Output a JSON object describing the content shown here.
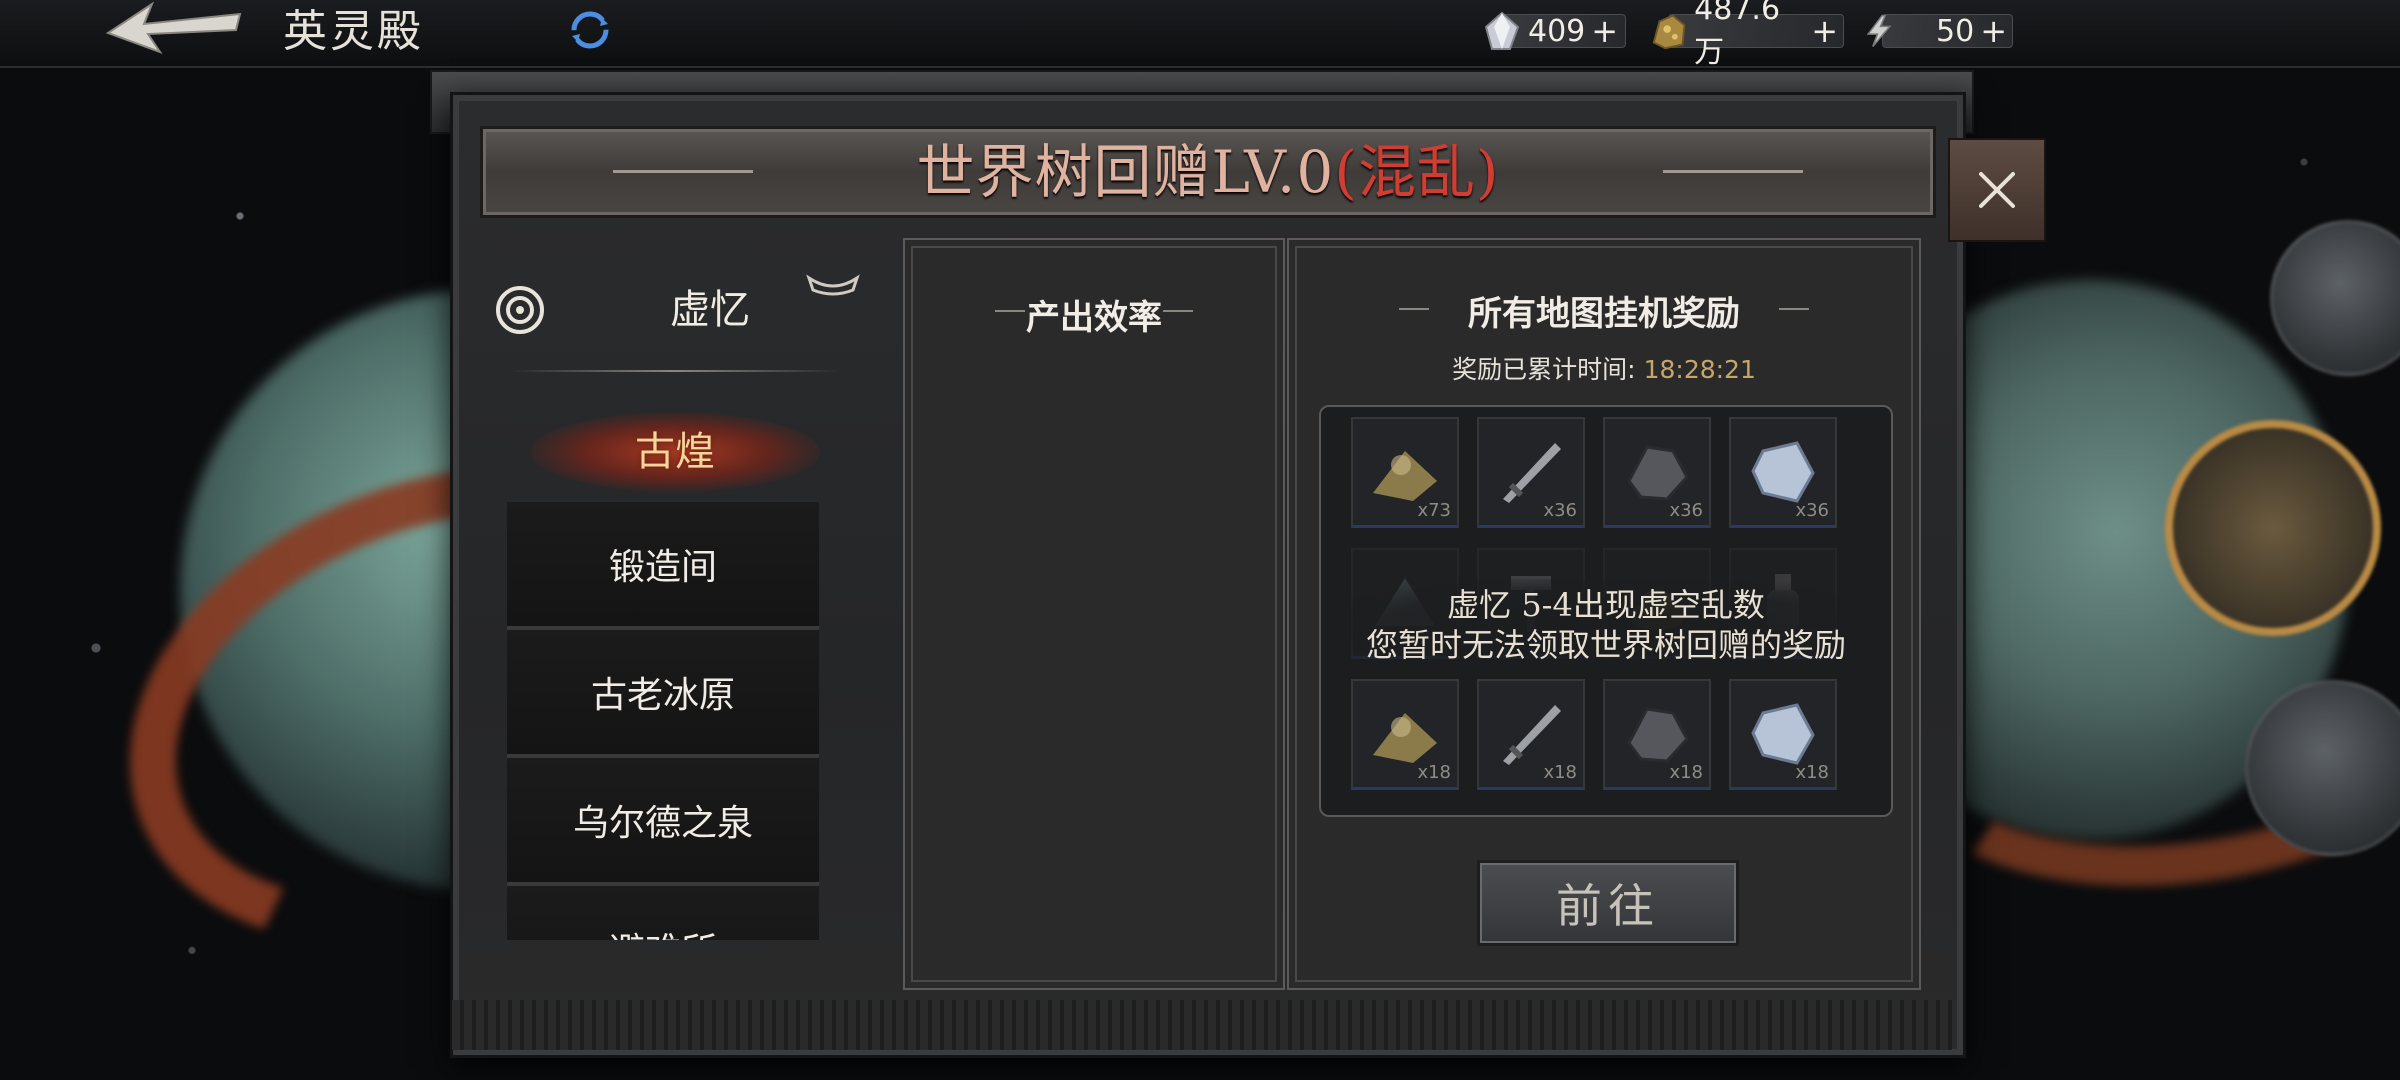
{
  "topbar": {
    "title": "英灵殿",
    "resources": [
      {
        "icon": "crystal-icon",
        "value": "409",
        "plus": "+"
      },
      {
        "icon": "gold-ore-icon",
        "value": "487.6万",
        "plus": "+"
      },
      {
        "icon": "lightning-icon",
        "value": "50",
        "plus": "+"
      }
    ]
  },
  "dialog": {
    "title_main": "世界树回赠LV.0",
    "title_status": "(混乱)",
    "nav": {
      "header": "虚忆",
      "active": "古煌",
      "items": [
        "锻造间",
        "古老冰原",
        "乌尔德之泉",
        "避难所"
      ]
    },
    "output_section": {
      "title": "产出效率"
    },
    "reward_section": {
      "title": "所有地图挂机奖励",
      "timer_label": "奖励已累计时间:",
      "timer_value": "18:28:21",
      "items": [
        {
          "icon": "scroll-dust-icon",
          "qty": "x73"
        },
        {
          "icon": "sword-icon",
          "qty": "x36"
        },
        {
          "icon": "ore-chunk-icon",
          "qty": "x36"
        },
        {
          "icon": "blue-crystal-icon",
          "qty": "x36"
        },
        {
          "icon": "tent-icon",
          "qty": ""
        },
        {
          "icon": "hammer-icon",
          "qty": ""
        },
        {
          "icon": "gold-pile-icon",
          "qty": ""
        },
        {
          "icon": "bottle-icon",
          "qty": ""
        },
        {
          "icon": "scroll-dust-icon",
          "qty": "x18"
        },
        {
          "icon": "sword-icon",
          "qty": "x18"
        },
        {
          "icon": "ore-chunk-icon",
          "qty": "x18"
        },
        {
          "icon": "blue-crystal-icon",
          "qty": "x18"
        }
      ],
      "message_line1": "虚忆 5-4出现虚空乱数",
      "message_line2": "您暂时无法领取世界树回赠的奖励",
      "go_button": "前往"
    }
  },
  "colors": {
    "title": "#e0b3a1",
    "status_chaos": "#cf3d33",
    "timer": "#c8a56a",
    "active_nav": "#f6d49a"
  }
}
